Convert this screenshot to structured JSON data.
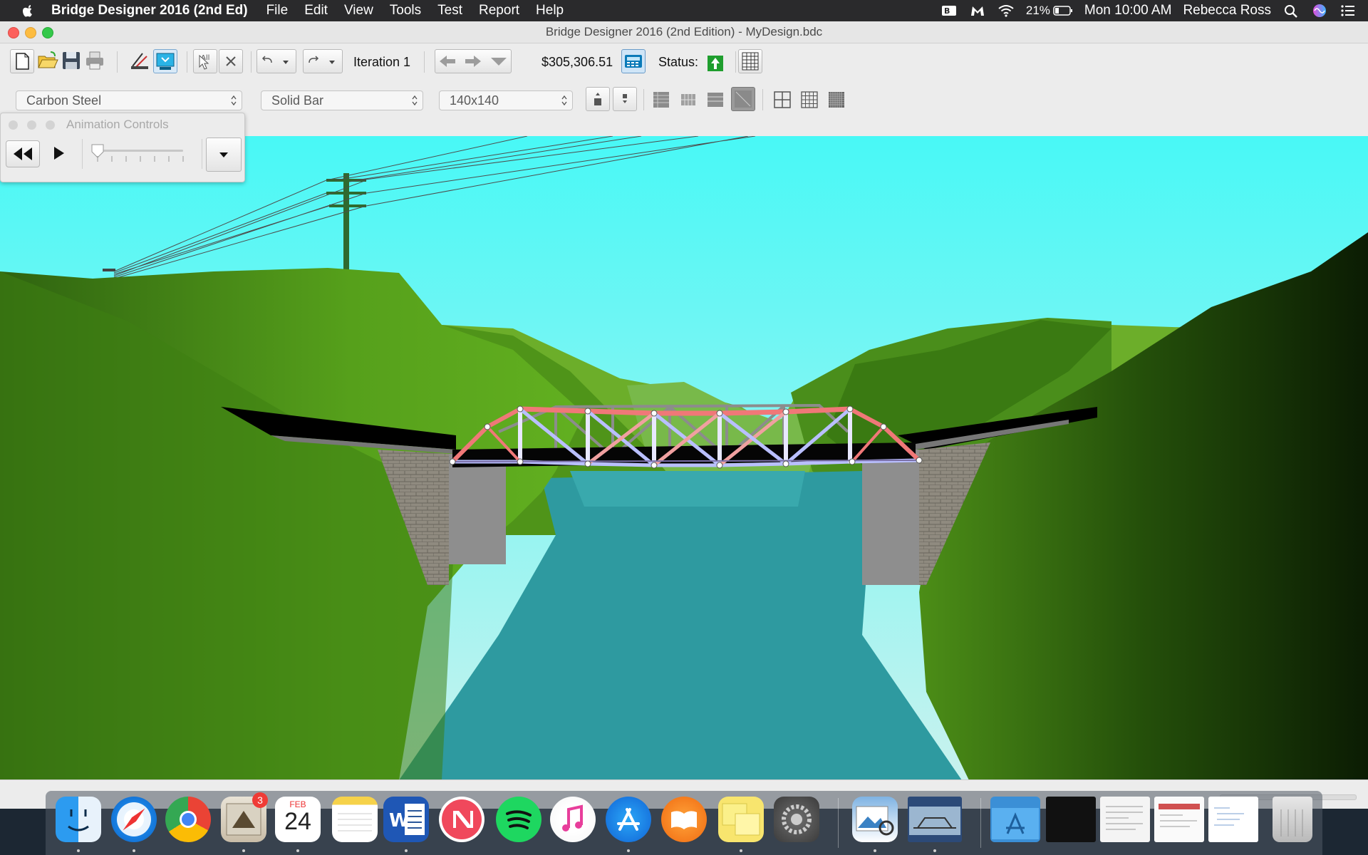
{
  "menubar": {
    "app_name": "Bridge Designer 2016 (2nd Ed)",
    "items": [
      "File",
      "Edit",
      "View",
      "Tools",
      "Test",
      "Report",
      "Help"
    ],
    "battery": "21%",
    "clock": "Mon 10:00 AM",
    "user": "Rebecca Ross"
  },
  "window": {
    "title": "Bridge Designer 2016 (2nd Edition) - MyDesign.bdc"
  },
  "toolbar": {
    "iteration_label": "Iteration 1",
    "cost": "$305,306.51",
    "status_label": "Status:",
    "status_color": "#1f9e2e"
  },
  "selectors": {
    "material": "Carbon Steel",
    "cross_section": "Solid Bar",
    "size": "140x140"
  },
  "animation_controls": {
    "title": "Animation Controls"
  },
  "dock": {
    "calendar_month": "FEB",
    "calendar_day": "24",
    "mail_badge": "3"
  },
  "colors": {
    "sky": "#55f7f5",
    "water": "#2e9aa0",
    "hill": "#5ba31d",
    "compression_member": "#f07878",
    "tension_member": "#b9bfff"
  }
}
